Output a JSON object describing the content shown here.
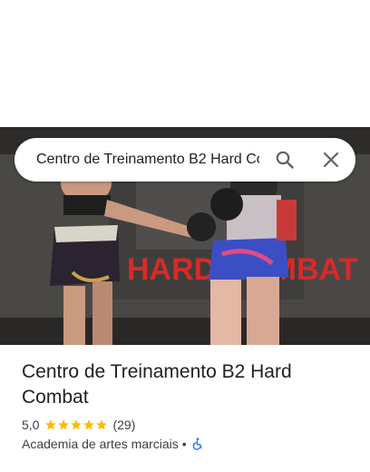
{
  "search": {
    "value": "Centro de Treinamento B2 Hard Combat",
    "search_icon": "search-icon",
    "close_icon": "close-icon"
  },
  "photo": {
    "description_icon": "place-photo",
    "sign_text": "HARD COMBAT"
  },
  "place": {
    "title": "Centro de Treinamento B2 Hard Combat",
    "rating": "5,0",
    "stars": 5,
    "review_count": "(29)",
    "category": "Academia de artes marciais",
    "separator": "•",
    "accessibility_icon": "wheelchair-icon"
  },
  "colors": {
    "star": "#fbbc04",
    "accessibility": "#1a73e8",
    "icon_gray": "#5f6368"
  }
}
